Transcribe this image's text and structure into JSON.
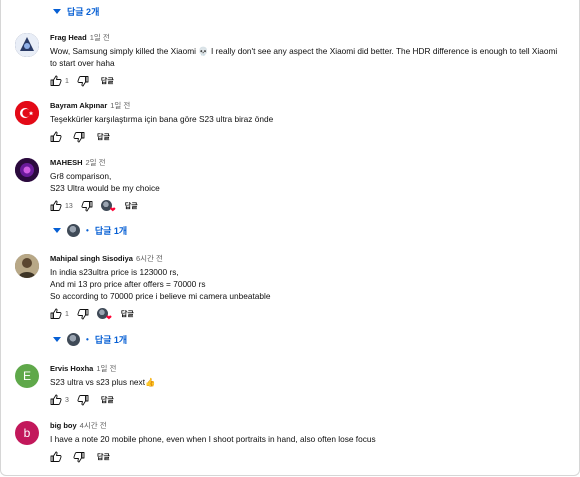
{
  "top_replies_toggle": {
    "label": "답글 2개"
  },
  "comments": [
    {
      "author": "Frag Head",
      "time": "1일 전",
      "text_lines": [
        "Wow, Samsung simply killed the Xiaomi 💀 I really don't see any aspect the Xiaomi did better. The HDR difference is enough to tell Xiaomi",
        "to start over haha"
      ],
      "likes": "1",
      "reply_label": "답글",
      "avatar_color": "#2a3b66"
    },
    {
      "author": "Bayram Akpınar",
      "time": "1일 전",
      "text_lines": [
        "Teşekkürler karşılaştırma için bana göre S23 ultra biraz önde"
      ],
      "likes": "",
      "reply_label": "답글",
      "avatar_color": "#e30a17"
    },
    {
      "author": "MAHESH",
      "time": "2일 전",
      "text_lines": [
        "Gr8 comparison,",
        "S23 Ultra would be my choice"
      ],
      "likes": "13",
      "reply_label": "답글",
      "avatar_color": "#3a0f4f",
      "replies_label": "답글 1개"
    },
    {
      "author": "Mahipal singh Sisodiya",
      "time": "6시간 전",
      "text_lines": [
        "In india s23ultra price is 123000 rs,",
        "And mi 13 pro price after offers = 70000 rs",
        "So according to 70000 price i believe mi camera unbeatable"
      ],
      "likes": "1",
      "reply_label": "답글",
      "avatar_color": "#7a6a4f",
      "replies_label": "답글 1개"
    },
    {
      "author": "Ervis Hoxha",
      "time": "1일 전",
      "text_lines": [
        "S23 ultra vs s23 plus next👍"
      ],
      "likes": "3",
      "reply_label": "답글",
      "avatar_color": "#5fa84a",
      "avatar_letter": "E"
    },
    {
      "author": "big boy",
      "time": "4시간 전",
      "text_lines": [
        "I have a note 20 mobile phone, even when I shoot portraits in hand, also often lose focus"
      ],
      "likes": "",
      "reply_label": "답글",
      "avatar_color": "#c2185b",
      "avatar_letter": "b"
    }
  ]
}
